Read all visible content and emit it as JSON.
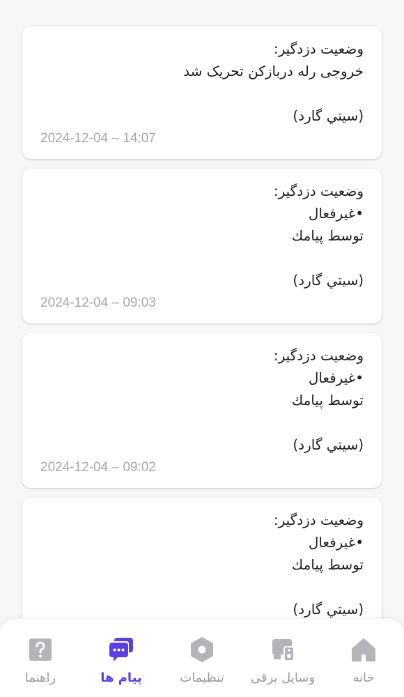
{
  "messages": [
    {
      "text": "وضعیت دزدگیر:\nخروجی رله دربازکن تحریک شد\n\n(سيتي گارد)",
      "time": "2024-12-04 – 14:07"
    },
    {
      "text": "وضعیت دزدگیر:\n•غیرفعال\nتوسط پیامك\n\n(سيتي گارد)",
      "time": "2024-12-04 – 09:03"
    },
    {
      "text": "وضعیت دزدگیر:\n•غیرفعال\nتوسط پیامك\n\n(سيتي گارد)",
      "time": "2024-12-04 – 09:02"
    },
    {
      "text": "وضعیت دزدگیر:\n•غیرفعال\nتوسط پیامك\n\n(سيتي گارد)",
      "time": ""
    }
  ],
  "nav": {
    "items": [
      {
        "label": "خانه",
        "icon": "home-icon"
      },
      {
        "label": "وسایل برقی",
        "icon": "devices-icon"
      },
      {
        "label": "تنظیمات",
        "icon": "settings-icon"
      },
      {
        "label": "پیام ها",
        "icon": "messages-icon",
        "active": true
      },
      {
        "label": "راهنما",
        "icon": "help-icon"
      }
    ],
    "active_color": "#5b3fe0",
    "inactive_color": "#b5b5b9"
  }
}
